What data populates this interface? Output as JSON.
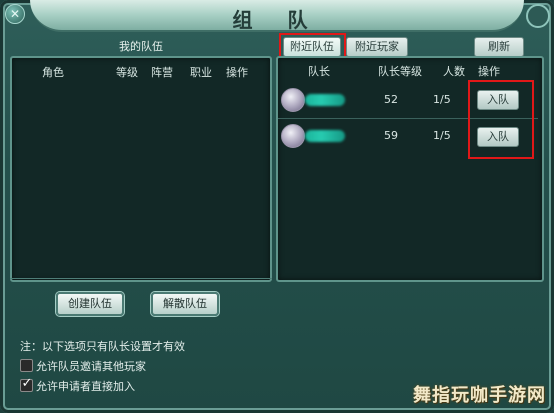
{
  "window": {
    "title": "组 队"
  },
  "left_panel": {
    "title": "我的队伍",
    "columns": [
      "角色",
      "等级",
      "阵营",
      "职业",
      "操作"
    ],
    "create_button": "创建队伍",
    "disband_button": "解散队伍"
  },
  "right_panel": {
    "tabs": [
      "附近队伍",
      "附近玩家"
    ],
    "refresh_button": "刷新",
    "columns": [
      "队长",
      "队长等级",
      "人数",
      "操作"
    ],
    "rows": [
      {
        "level": "52",
        "members": "1/5",
        "action": "入队"
      },
      {
        "level": "59",
        "members": "1/5",
        "action": "入队"
      }
    ]
  },
  "options": {
    "note": "注：以下选项只有队长设置才有效",
    "items": [
      {
        "label": "允许队员邀请其他玩家",
        "checked": false
      },
      {
        "label": "允许申请者直接加入",
        "checked": true
      }
    ]
  },
  "watermark": "舞指玩咖手游网",
  "colors": {
    "highlight": "#e01818",
    "blurred_name": "#27cbb0"
  }
}
